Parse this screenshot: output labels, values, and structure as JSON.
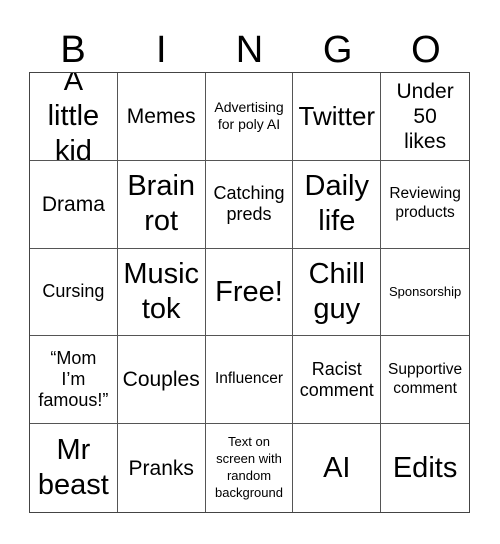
{
  "card": {
    "header": [
      "B",
      "I",
      "N",
      "G",
      "O"
    ],
    "rows": [
      [
        "A little kid",
        "Memes",
        "Advertising for poly AI",
        "Twitter",
        "Under 50 likes"
      ],
      [
        "Drama",
        "Brain rot",
        "Catching preds",
        "Daily life",
        "Reviewing products"
      ],
      [
        "Cursing",
        "Music tok",
        "Free!",
        "Chill guy",
        "Sponsorship"
      ],
      [
        "“Mom I’m famous!”",
        "Couples",
        "Influencer",
        "Racist comment",
        "Supportive comment"
      ],
      [
        "Mr beast",
        "Pranks",
        "Text on screen with random background",
        "AI",
        "Edits"
      ]
    ],
    "free_space": "Free!"
  },
  "colors": {
    "text": "#000000",
    "grid_line": "#555555",
    "background": "#ffffff"
  }
}
